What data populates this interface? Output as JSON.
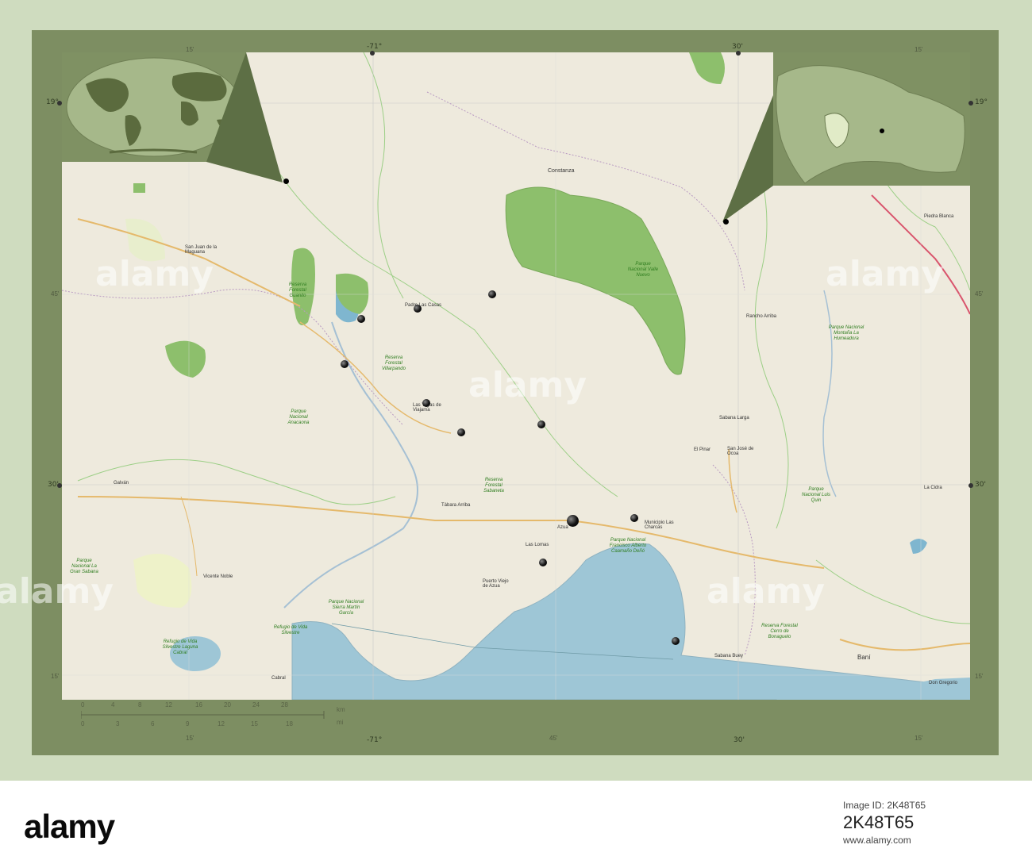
{
  "map": {
    "coords": {
      "top_lon_center": "-71°",
      "top_lon_right": "30'",
      "bottom_lon_center": "-71°",
      "bottom_lon_right": "30'",
      "left_lat_top": "19°",
      "right_lat_top": "19°",
      "left_lat_mid": "30'",
      "right_lat_mid": "30'",
      "minor_15": "15'",
      "minor_45": "45'"
    },
    "places": {
      "constanza": "Constanza",
      "san_juan": "San Juan de la Maguana",
      "sabana_larga": "Sabana Larga",
      "san_jose_ocoa": "San José de Ocoa",
      "azua": "Azua",
      "municipio_las_charcas": "Municipio Las Charcas",
      "vicente_noble": "Vicente Noble",
      "bani": "Baní",
      "cabral": "Cabral",
      "galvan": "Galván",
      "padre_las_casas": "Padre Las Casas",
      "las_yayas": "Las Yayas de Viajama",
      "tabara_arriba": "Tábara Arriba",
      "puerto_viejo": "Puerto Viejo de Azua",
      "las_lomas": "Las Lomas",
      "rancho_arriba": "Rancho Arriba",
      "la_cidra": "La Cidra",
      "don_gregorio": "Don Gregorio",
      "piedra_blanca": "Piedra Blanca",
      "el_pinar": "El Pinar",
      "sabana_buey": "Sabana Buey"
    },
    "parks": {
      "anacaona": "Parque Nacional Anacaona",
      "villarpando": "Reserva Forestal Villarpando",
      "valle_nuevo": "Parque Nacional Valle Nuevo",
      "humeadora": "Parque Nacional Montaña La Humeadora",
      "luis_quin": "Parque Nacional Luis Quin",
      "gran_sabana": "Parque Nacional La Gran Sabana",
      "sierra_martin_garcia": "Parque Nacional Sierra Martín García",
      "francisco_caamano": "Parque Nacional Francisco Alberto Caamaño Deñó",
      "cerro_bonaguelo": "Reserva Forestal Cerro de Bonaguelo",
      "sabaneta": "Reserva Forestal Sabaneta",
      "guanito": "Reserva Forestal Guanito",
      "laguna_cabral": "Refugio de Vida Silvestre Laguna Cabral",
      "bahia_ocoa": "Refugio de Vida Silvestre"
    },
    "scale": {
      "km_unit": "km",
      "mi_unit": "mi",
      "km_ticks": [
        "0",
        "4",
        "8",
        "12",
        "16",
        "20",
        "24",
        "28"
      ],
      "mi_ticks": [
        "0",
        "3",
        "6",
        "9",
        "12",
        "15",
        "18"
      ]
    },
    "markers": [
      {
        "name": "marker-1"
      },
      {
        "name": "marker-2"
      },
      {
        "name": "marker-3"
      },
      {
        "name": "marker-4"
      },
      {
        "name": "marker-5"
      },
      {
        "name": "marker-6"
      },
      {
        "name": "marker-7"
      },
      {
        "name": "marker-8"
      },
      {
        "name": "marker-capital"
      },
      {
        "name": "marker-9"
      },
      {
        "name": "marker-10"
      }
    ],
    "colors": {
      "frame": "#7d8e62",
      "land": "#eeeadd",
      "park": "#8dbf6c",
      "water": "#9ec6d6",
      "page_bg": "#cfdcbf"
    }
  },
  "watermark": "alamy",
  "footer": {
    "logo": "alamy",
    "image_id_label": "Image ID: 2K48T65",
    "image_id": "2K48T65",
    "url": "www.alamy.com"
  }
}
